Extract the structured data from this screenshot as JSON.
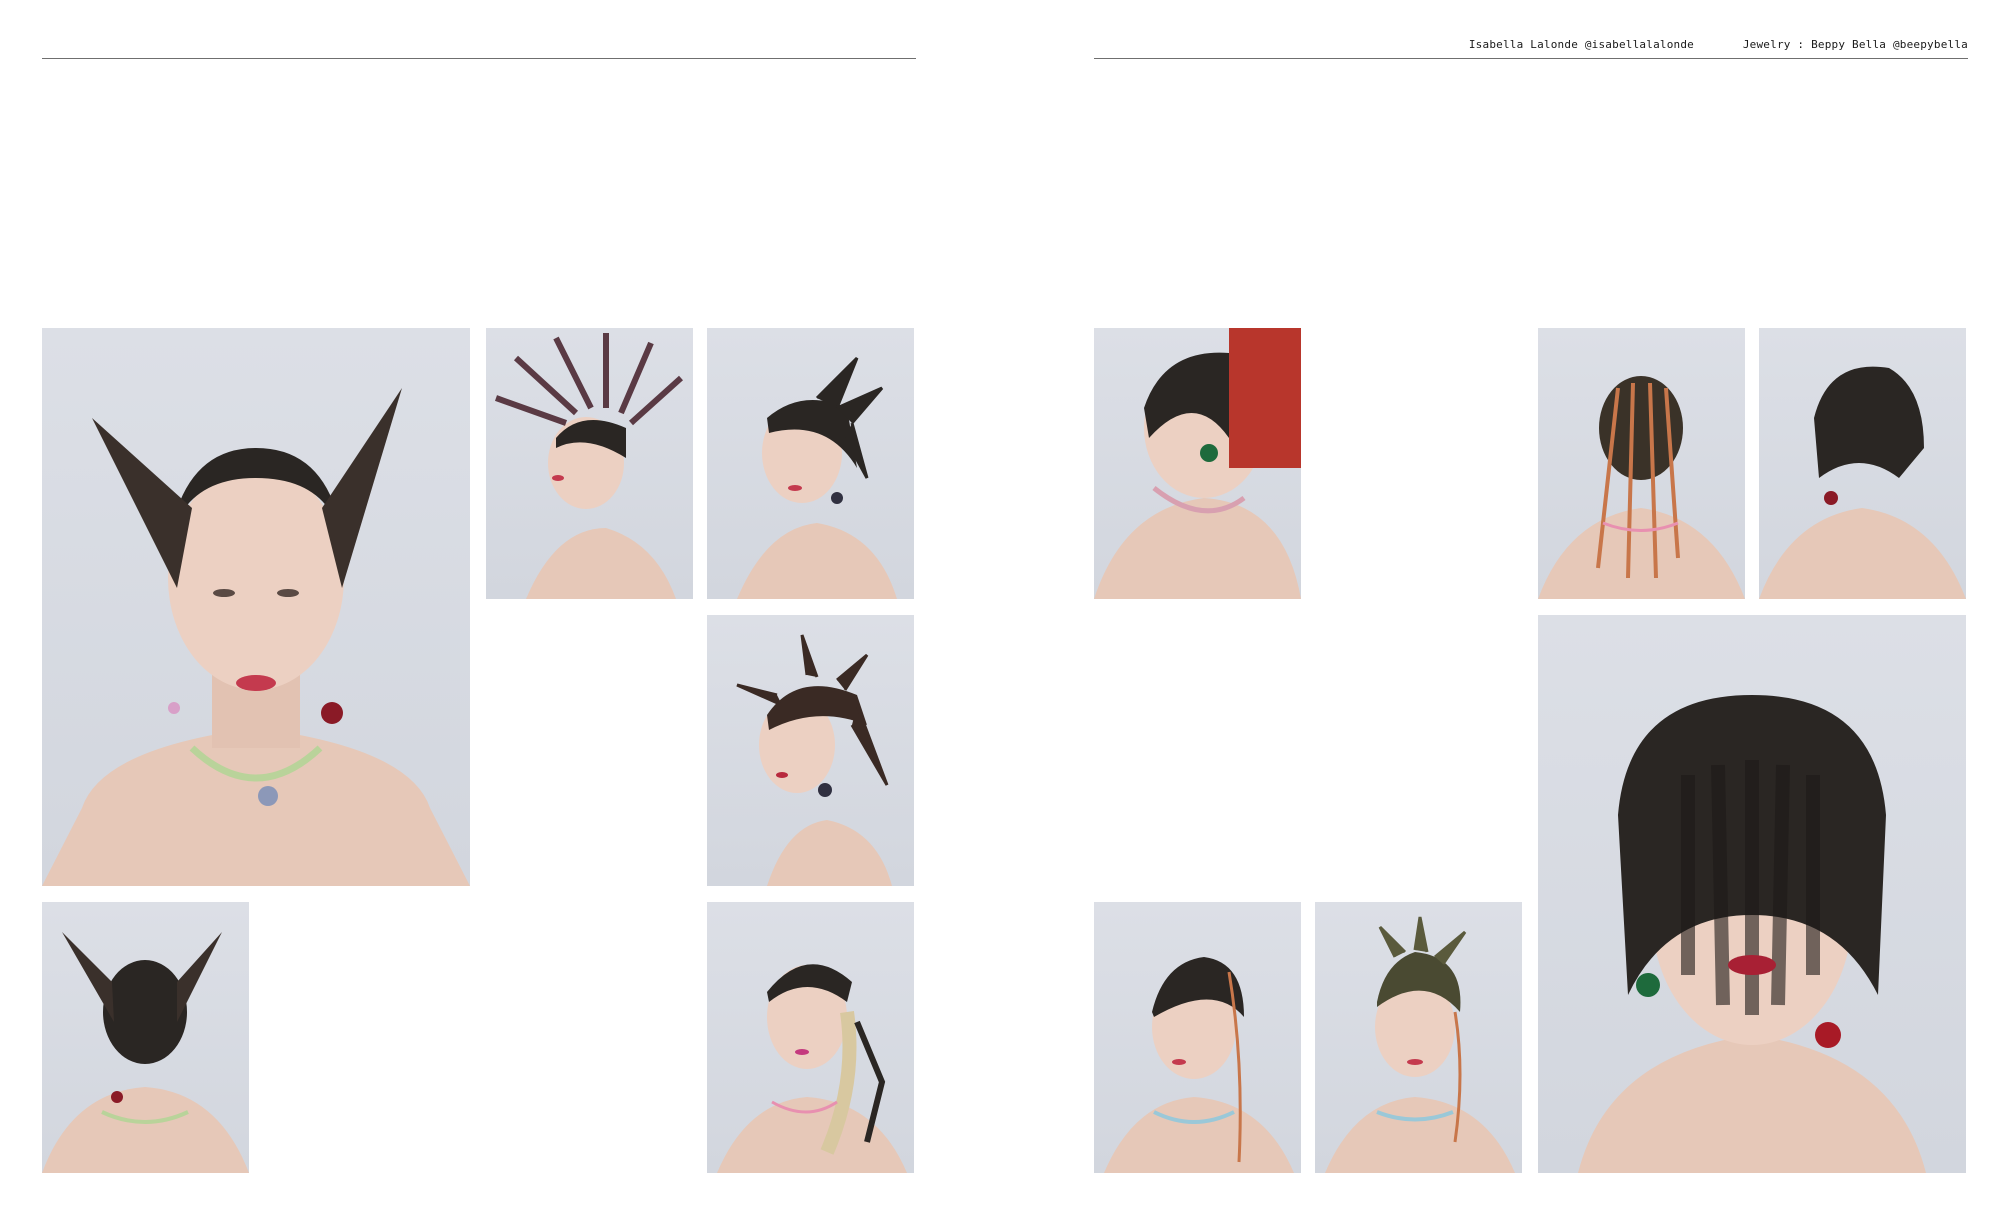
{
  "header": {
    "photographer": "Isabella Lalonde @isabellalalonde",
    "jewelry": "Jewelry : Beppy Bella @beepybella"
  },
  "photos": [
    {
      "id": "p1",
      "subject": "portrait-front-pointed-horn-hair"
    },
    {
      "id": "p2",
      "subject": "profile-spiked-fan-mohawk"
    },
    {
      "id": "p3",
      "subject": "three-quarter-spiked-mohawk"
    },
    {
      "id": "p4",
      "subject": "profile-spiky-mohawk"
    },
    {
      "id": "p5",
      "subject": "back-view-pointed-horn-hair"
    },
    {
      "id": "p6",
      "subject": "portrait-fringe-with-braid-extension"
    },
    {
      "id": "p7",
      "subject": "profile-red-hair-panel"
    },
    {
      "id": "p8",
      "subject": "back-view-hair-strands"
    },
    {
      "id": "p9",
      "subject": "back-view-short-bob"
    },
    {
      "id": "p10",
      "subject": "portrait-long-fringe-bob"
    },
    {
      "id": "p11",
      "subject": "portrait-buzzcut-with-strand"
    },
    {
      "id": "p12",
      "subject": "portrait-tousled-mohawk"
    }
  ],
  "colors": {
    "backdrop": "#d6d9e0",
    "skin": "#e6c8b8",
    "hair": "#2a2623",
    "red_hair": "#b8362c",
    "lips": "#c43a4e"
  }
}
